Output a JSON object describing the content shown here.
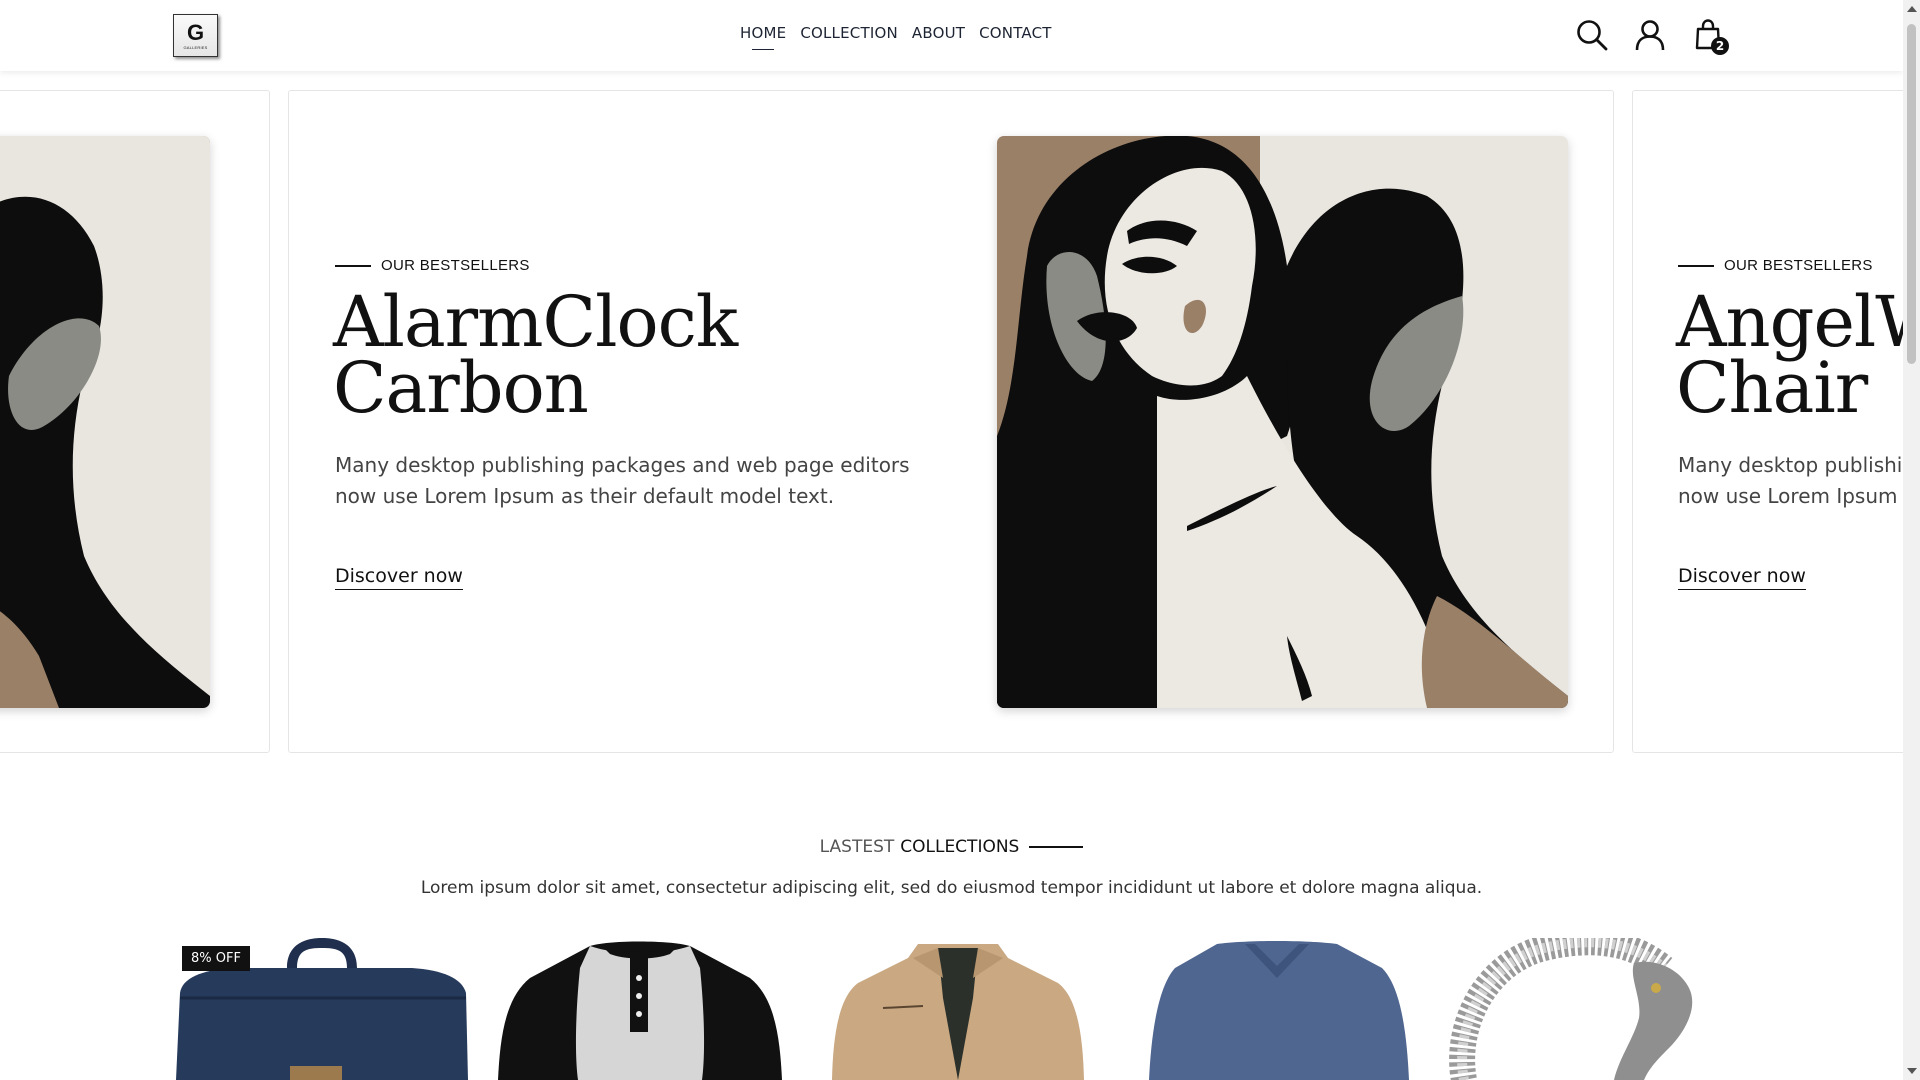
{
  "header": {
    "logo_letter": "G",
    "logo_sub": "GALLERIES",
    "nav": [
      {
        "label": "HOME",
        "active": true
      },
      {
        "label": "COLLECTION",
        "active": false
      },
      {
        "label": "ABOUT",
        "active": false
      },
      {
        "label": "CONTACT",
        "active": false
      }
    ],
    "cart_count": "2"
  },
  "hero": {
    "slides": [
      {
        "eyebrow": "OUR BESTSELLERS",
        "title_line1": "AlarmClock",
        "title_line2": "Carbon",
        "description": "Many desktop publishing packages and web page editors now use Lorem Ipsum as their default model text.",
        "cta": "Discover now"
      },
      {
        "eyebrow": "OUR BESTSELLERS",
        "title_line1": "AngelW",
        "title_line2": "Chair",
        "description": "Many desktop publishing packages and web page editors now use Lorem Ipsum as their default model text.",
        "cta": "Discover now"
      }
    ]
  },
  "collections": {
    "heading_light": "LASTEST",
    "heading_bold": "COLLECTIONS",
    "subtitle": "Lorem ipsum dolor sit amet, consectetur adipiscing elit, sed do eiusmod tempor incididunt ut labore et dolore magna aliqua.",
    "products": [
      {
        "name": "backpack",
        "badge": "8% OFF"
      },
      {
        "name": "raglan-henley-shirt",
        "badge": ""
      },
      {
        "name": "tan-jacket",
        "badge": ""
      },
      {
        "name": "blue-vneck-shirt",
        "badge": ""
      },
      {
        "name": "dragon-bracelet",
        "badge": ""
      }
    ]
  },
  "colors": {
    "accent": "#111111",
    "art_tan": "#9b8068",
    "art_cream": "#e9e5df",
    "art_gray": "#8a8b85"
  }
}
